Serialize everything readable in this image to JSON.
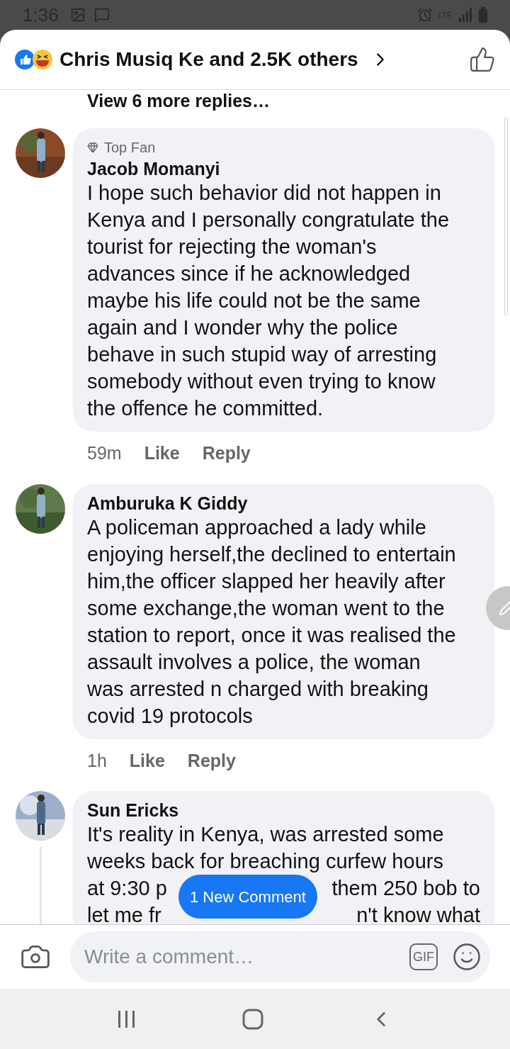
{
  "status_bar": {
    "time": "1:36",
    "network": "LTE"
  },
  "header": {
    "reactions_text": "Chris Musiq Ke and 2.5K others"
  },
  "view_more": "View 6 more replies…",
  "comments": [
    {
      "badge": "Top Fan",
      "name": "Jacob Momanyi",
      "lines": [
        [
          "I hope such behavior did not happen in"
        ],
        [
          "Kenya and I personally congratulate the"
        ],
        [
          "tourist for rejecting the woman's"
        ],
        [
          "advances since if he acknowledged"
        ],
        [
          "maybe his life could not be the same"
        ],
        [
          "again and I wonder why the police"
        ],
        [
          "behave in such stupid way of arresting"
        ],
        [
          "somebody without even trying to know"
        ],
        [
          "the offence he committed."
        ]
      ],
      "time": "59m",
      "actions": [
        "Like",
        "Reply"
      ],
      "thread": false
    },
    {
      "name": "Amburuka K Giddy",
      "lines": [
        [
          "A policeman approached a lady while"
        ],
        [
          "enjoying herself,the declined to entertain"
        ],
        [
          "him,the officer slapped her heavily after"
        ],
        [
          "some exchange,the woman went to the"
        ],
        [
          "station to report, once it was realised the"
        ],
        [
          "assault involves a police, the woman"
        ],
        [
          "was arrested n charged with breaking"
        ],
        [
          "covid 19 protocols"
        ]
      ],
      "time": "1h",
      "actions": [
        "Like",
        "Reply"
      ],
      "thread": false
    },
    {
      "name": "Sun Ericks",
      "lines": [
        [
          "It's reality in Kenya, was arrested some"
        ],
        [
          "weeks back for breaching curfew hours"
        ],
        [
          "at 9:30 p",
          "them 250 bob to"
        ],
        [
          "let me fr",
          "n't know what"
        ]
      ],
      "thread": true
    }
  ],
  "new_comment_button": "1 New Comment",
  "composer": {
    "placeholder": "Write a comment…",
    "gif": "GIF"
  }
}
